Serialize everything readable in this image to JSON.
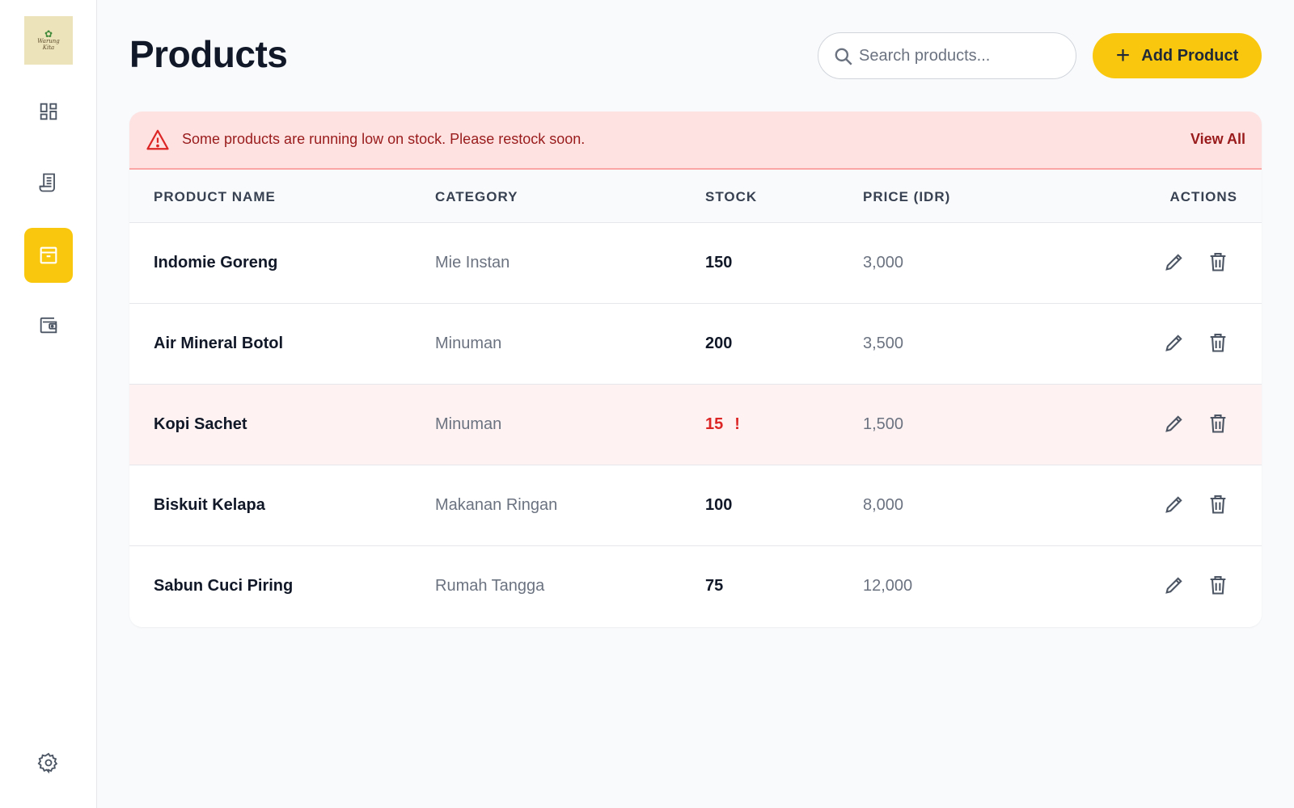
{
  "logo": {
    "text_line1": "Warung",
    "text_line2": "Kita"
  },
  "sidebar": {
    "items": [
      {
        "name": "dashboard",
        "icon": "dashboard-icon"
      },
      {
        "name": "receipts",
        "icon": "receipt-icon"
      },
      {
        "name": "products",
        "icon": "archive-box-icon",
        "active": true
      },
      {
        "name": "wallet",
        "icon": "wallet-icon"
      }
    ],
    "settings_icon": "gear-icon"
  },
  "header": {
    "title": "Products",
    "search_placeholder": "Search products...",
    "add_button_label": "Add Product"
  },
  "alert": {
    "message": "Some products are running low on stock. Please restock soon.",
    "action_label": "View All"
  },
  "table": {
    "columns": [
      "PRODUCT NAME",
      "CATEGORY",
      "STOCK",
      "PRICE (IDR)",
      "ACTIONS"
    ],
    "rows": [
      {
        "name": "Indomie Goreng",
        "category": "Mie Instan",
        "stock": "150",
        "price": "3,000",
        "low": false
      },
      {
        "name": "Air Mineral Botol",
        "category": "Minuman",
        "stock": "200",
        "price": "3,500",
        "low": false
      },
      {
        "name": "Kopi Sachet",
        "category": "Minuman",
        "stock": "15",
        "price": "1,500",
        "low": true,
        "flag": "!"
      },
      {
        "name": "Biskuit Kelapa",
        "category": "Makanan Ringan",
        "stock": "100",
        "price": "8,000",
        "low": false
      },
      {
        "name": "Sabun Cuci Piring",
        "category": "Rumah Tangga",
        "stock": "75",
        "price": "12,000",
        "low": false
      }
    ]
  },
  "colors": {
    "accent": "#f9c80e",
    "alert_bg": "#fee2e2",
    "alert_text": "#991b1b",
    "low_stock": "#dc2626"
  }
}
